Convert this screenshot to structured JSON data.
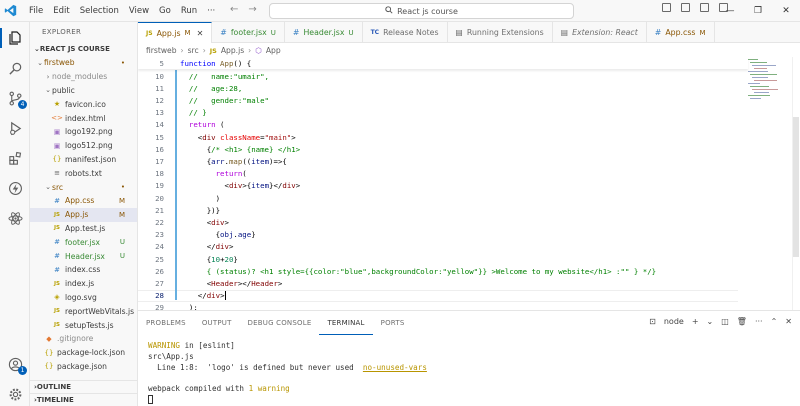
{
  "menu": [
    "File",
    "Edit",
    "Selection",
    "View",
    "Go",
    "Run",
    "···"
  ],
  "search": {
    "text": "React js course"
  },
  "sidebar": {
    "title": "EXPLORER",
    "section": "REACT JS COURSE",
    "tree": [
      {
        "label": "firstweb",
        "kind": "folder-open",
        "status": "•"
      },
      {
        "label": "node_modules",
        "kind": "folder",
        "status": ""
      },
      {
        "label": "public",
        "kind": "folder-open",
        "status": ""
      },
      {
        "label": "favicon.ico",
        "kind": "star",
        "status": ""
      },
      {
        "label": "index.html",
        "kind": "html",
        "status": ""
      },
      {
        "label": "logo192.png",
        "kind": "image",
        "status": ""
      },
      {
        "label": "logo512.png",
        "kind": "image",
        "status": ""
      },
      {
        "label": "manifest.json",
        "kind": "json",
        "status": ""
      },
      {
        "label": "robots.txt",
        "kind": "text",
        "status": ""
      },
      {
        "label": "src",
        "kind": "folder-open",
        "status": "•"
      },
      {
        "label": "App.css",
        "kind": "css",
        "status": "M"
      },
      {
        "label": "App.js",
        "kind": "js",
        "status": "M"
      },
      {
        "label": "App.test.js",
        "kind": "js",
        "status": ""
      },
      {
        "label": "footer.jsx",
        "kind": "css",
        "status": "U"
      },
      {
        "label": "Header.jsx",
        "kind": "css",
        "status": "U"
      },
      {
        "label": "index.css",
        "kind": "css",
        "status": ""
      },
      {
        "label": "index.js",
        "kind": "js",
        "status": ""
      },
      {
        "label": "logo.svg",
        "kind": "svg",
        "status": ""
      },
      {
        "label": "reportWebVitals.js",
        "kind": "js",
        "status": ""
      },
      {
        "label": "setupTests.js",
        "kind": "js",
        "status": ""
      },
      {
        "label": ".gitignore",
        "kind": "git",
        "status": ""
      },
      {
        "label": "package-lock.json",
        "kind": "json",
        "status": ""
      },
      {
        "label": "package.json",
        "kind": "json",
        "status": ""
      }
    ],
    "outline": "OUTLINE",
    "timeline": "TIMELINE"
  },
  "activity_badges": {
    "source_control": "4",
    "accounts": "1"
  },
  "tabs": [
    {
      "label": "App.js",
      "status": "M",
      "icon": "JS",
      "active": true
    },
    {
      "label": "footer.jsx",
      "status": "U",
      "icon": "#",
      "active": false
    },
    {
      "label": "Header.jsx",
      "status": "U",
      "icon": "#",
      "active": false
    },
    {
      "label": "Release Notes",
      "status": "",
      "icon": "TC",
      "active": false
    },
    {
      "label": "Running Extensions",
      "status": "",
      "icon": "doc",
      "active": false
    },
    {
      "label": "Extension: React",
      "status": "",
      "icon": "doc",
      "active": false
    },
    {
      "label": "App.css",
      "status": "M",
      "icon": "#",
      "active": false
    }
  ],
  "breadcrumb": [
    "firstweb",
    "src",
    "App.js",
    "App"
  ],
  "editor": {
    "sticky": {
      "line": "5",
      "segments": [
        [
          "kw",
          "function "
        ],
        [
          "fn",
          "App"
        ],
        [
          "p",
          "() {"
        ]
      ]
    },
    "lines": [
      {
        "n": "10",
        "segments": [
          [
            "cm",
            "  //   name:\"umair\","
          ]
        ]
      },
      {
        "n": "11",
        "segments": [
          [
            "cm",
            "  //   age:28,"
          ]
        ]
      },
      {
        "n": "12",
        "segments": [
          [
            "cm",
            "  //   gender:\"male\""
          ]
        ]
      },
      {
        "n": "13",
        "segments": [
          [
            "cm",
            "  // }"
          ]
        ]
      },
      {
        "n": "14",
        "segments": [
          [
            "ctl",
            "  return "
          ],
          [
            "p",
            "("
          ]
        ]
      },
      {
        "n": "15",
        "segments": [
          [
            "p",
            "    <"
          ],
          [
            "tag",
            "div "
          ],
          [
            "attr",
            "className"
          ],
          [
            "p",
            "="
          ],
          [
            "str",
            "\"main\""
          ],
          [
            "p",
            ">"
          ]
        ]
      },
      {
        "n": "16",
        "segments": [
          [
            "p",
            "      {"
          ],
          [
            "cm",
            "/* <h1> {name} </h1>"
          ]
        ]
      },
      {
        "n": "17",
        "segments": [
          [
            "p",
            "      {"
          ],
          [
            "var",
            "arr"
          ],
          [
            "p",
            "."
          ],
          [
            "fn",
            "map"
          ],
          [
            "p",
            "(("
          ],
          [
            "var",
            "item"
          ],
          [
            "p",
            ")=>{"
          ]
        ]
      },
      {
        "n": "18",
        "segments": [
          [
            "ctl",
            "        return"
          ],
          [
            "p",
            "("
          ]
        ]
      },
      {
        "n": "19",
        "segments": [
          [
            "p",
            "          <"
          ],
          [
            "tag",
            "div"
          ],
          [
            "p",
            ">{"
          ],
          [
            "var",
            "item"
          ],
          [
            "p",
            "}</"
          ],
          [
            "tag",
            "div"
          ],
          [
            "p",
            ">"
          ]
        ]
      },
      {
        "n": "20",
        "segments": [
          [
            "p",
            "        )"
          ]
        ]
      },
      {
        "n": "21",
        "segments": [
          [
            "p",
            "      })}"
          ]
        ]
      },
      {
        "n": "22",
        "segments": [
          [
            "p",
            "      <"
          ],
          [
            "tag",
            "div"
          ],
          [
            "p",
            ">"
          ]
        ]
      },
      {
        "n": "23",
        "segments": [
          [
            "p",
            "        {"
          ],
          [
            "var",
            "obj"
          ],
          [
            "p",
            "."
          ],
          [
            "var",
            "age"
          ],
          [
            "p",
            "}"
          ]
        ]
      },
      {
        "n": "24",
        "segments": [
          [
            "p",
            "      </"
          ],
          [
            "tag",
            "div"
          ],
          [
            "p",
            ">"
          ]
        ]
      },
      {
        "n": "25",
        "segments": [
          [
            "p",
            "      {"
          ],
          [
            "num",
            "10"
          ],
          [
            "p",
            "+"
          ],
          [
            "num",
            "20"
          ],
          [
            "p",
            "}"
          ]
        ]
      },
      {
        "n": "26",
        "segments": [
          [
            "cm",
            "      { (status)? <h1 style={{color:\"blue\",backgroundColor:\"yellow\"}} >Welcome to my website</h1> :\"\" } */}"
          ]
        ]
      },
      {
        "n": "27",
        "segments": [
          [
            "p",
            "      <"
          ],
          [
            "tag",
            "Header"
          ],
          [
            "p",
            "></"
          ],
          [
            "tag",
            "Header"
          ],
          [
            "p",
            ">"
          ]
        ]
      },
      {
        "n": "28",
        "segments": [
          [
            "p",
            "    </"
          ],
          [
            "tag",
            "div"
          ],
          [
            "p",
            ">"
          ]
        ],
        "current": true
      },
      {
        "n": "29",
        "segments": [
          [
            "p",
            "  );"
          ]
        ]
      }
    ]
  },
  "panel": {
    "tabs": [
      "PROBLEMS",
      "OUTPUT",
      "DEBUG CONSOLE",
      "TERMINAL",
      "PORTS"
    ],
    "active_tab": "TERMINAL",
    "terminal_name": "node",
    "terminal": {
      "l1_a": "WARNING",
      "l1_b": " in [eslint]",
      "l2": "src\\App.js",
      "l3_a": "  Line 1:8:  'logo' is defined but never used  ",
      "l3_b": "no-unused-vars",
      "l5_a": "webpack compiled with ",
      "l5_b": "1 warning"
    }
  },
  "colors": {
    "accent": "#005fb8",
    "modified": "#895503",
    "untracked": "#388a34"
  }
}
